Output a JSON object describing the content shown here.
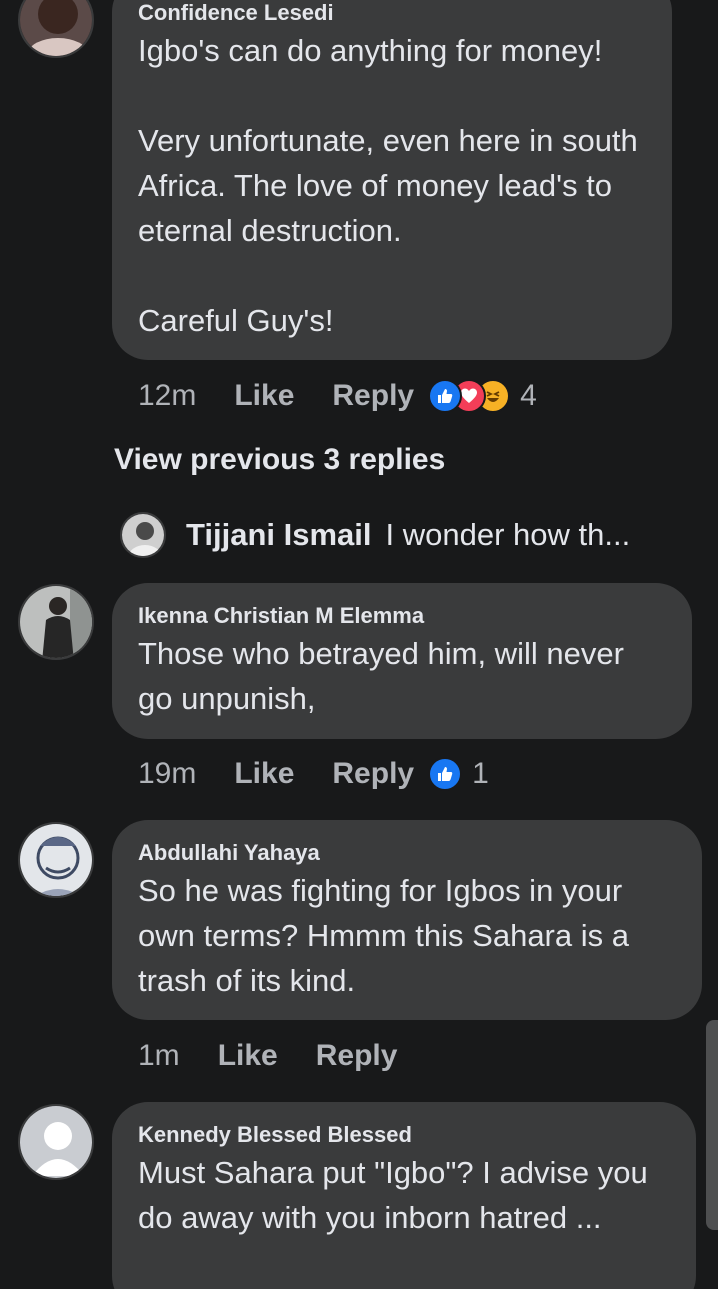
{
  "comments": [
    {
      "author": "Confidence Lesedi",
      "text": "Igbo's can do anything for money!\n\nVery unfortunate, even here in south Africa. The love of money lead's to eternal destruction.\n\nCareful Guy's!",
      "time": "12m",
      "like_label": "Like",
      "reply_label": "Reply",
      "reaction_count": "4",
      "reactions": [
        "like-icon",
        "love-icon",
        "haha-icon"
      ]
    },
    {
      "author": "Ikenna Christian M Elemma",
      "text": "Those who betrayed him, will never go unpunish,",
      "time": "19m",
      "like_label": "Like",
      "reply_label": "Reply",
      "reaction_count": "1",
      "reactions": [
        "like-icon"
      ]
    },
    {
      "author": "Abdullahi Yahaya",
      "text": "So he was fighting for Igbos in your own terms? Hmmm this Sahara is a trash of its kind.",
      "time": "1m",
      "like_label": "Like",
      "reply_label": "Reply"
    },
    {
      "author": "Kennedy Blessed Blessed",
      "text": "Must Sahara put \"Igbo\"? I advise you do away with you inborn hatred ..."
    }
  ],
  "replies_link": "View previous 3 replies",
  "reply_preview": {
    "author": "Tijjani Ismail",
    "text": "I wonder how th..."
  },
  "colors": {
    "background": "#18191a",
    "bubble": "#3a3b3c",
    "secondary_text": "#b0b3b8",
    "like_blue": "#1877f2",
    "love_red": "#f33e58",
    "haha_yellow": "#f7b125"
  }
}
